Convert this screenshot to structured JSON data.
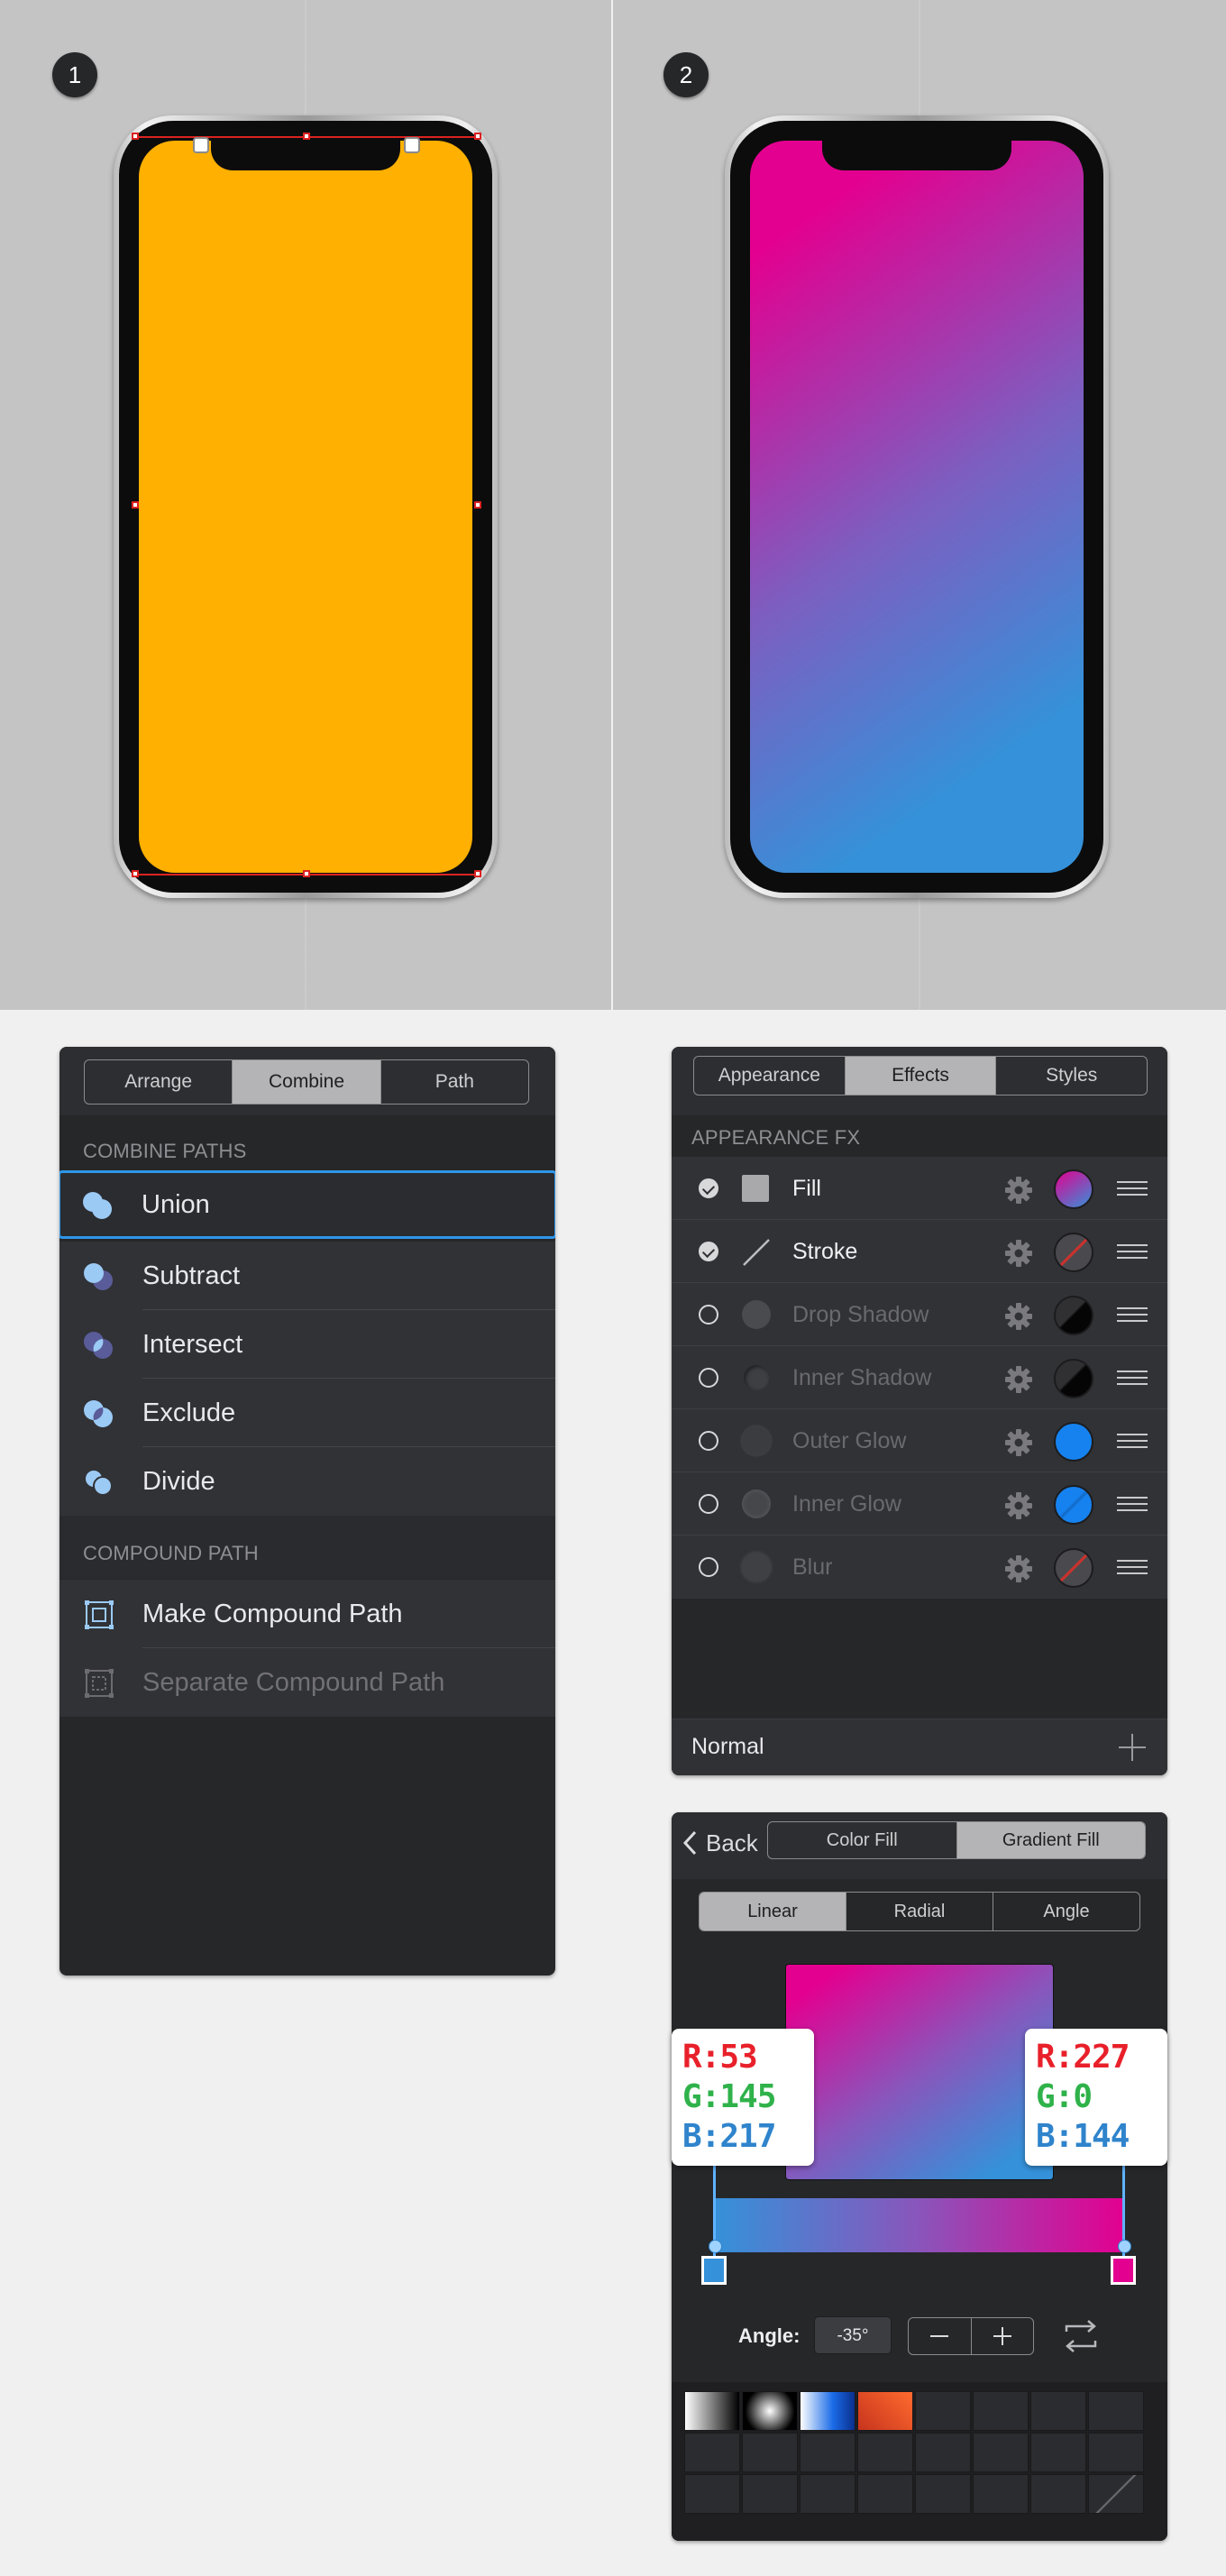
{
  "steps": [
    {
      "number": "1"
    },
    {
      "number": "2"
    }
  ],
  "arrange_panel": {
    "tabs": [
      "Arrange",
      "Combine",
      "Path"
    ],
    "active_tab": "Combine",
    "combine_paths": {
      "header": "COMBINE PATHS",
      "items": [
        {
          "label": "Union",
          "icon": "union-icon",
          "highlighted": true
        },
        {
          "label": "Subtract",
          "icon": "subtract-icon"
        },
        {
          "label": "Intersect",
          "icon": "intersect-icon"
        },
        {
          "label": "Exclude",
          "icon": "exclude-icon"
        },
        {
          "label": "Divide",
          "icon": "divide-icon"
        }
      ]
    },
    "compound_path": {
      "header": "COMPOUND PATH",
      "items": [
        {
          "label": "Make Compound Path",
          "icon": "make-compound-path-icon",
          "enabled": true
        },
        {
          "label": "Separate Compound Path",
          "icon": "separate-compound-path-icon",
          "enabled": false
        }
      ]
    }
  },
  "appearance_panel": {
    "tabs": [
      "Appearance",
      "Effects",
      "Styles"
    ],
    "active_tab": "Effects",
    "header": "APPEARANCE FX",
    "effects": [
      {
        "label": "Fill",
        "enabled": true
      },
      {
        "label": "Stroke",
        "enabled": true
      },
      {
        "label": "Drop Shadow",
        "enabled": false
      },
      {
        "label": "Inner Shadow",
        "enabled": false
      },
      {
        "label": "Outer Glow",
        "enabled": false
      },
      {
        "label": "Inner Glow",
        "enabled": false
      },
      {
        "label": "Blur",
        "enabled": false
      }
    ],
    "blend_mode": "Normal"
  },
  "gradient_panel": {
    "back_label": "Back",
    "fill_tabs": [
      "Color Fill",
      "Gradient Fill"
    ],
    "active_fill_tab": "Gradient Fill",
    "type_tabs": [
      "Linear",
      "Radial",
      "Angle"
    ],
    "active_type_tab": "Linear",
    "stops": [
      {
        "r_label": "R:53",
        "g_label": "G:145",
        "b_label": "B:217",
        "color": "#3591d9"
      },
      {
        "r_label": "R:227",
        "g_label": "G:0",
        "b_label": "B:144",
        "color": "#e30090"
      }
    ],
    "angle_label": "Angle:",
    "angle_value": "-35°"
  },
  "colors": {
    "fill_orange": "#ffb000",
    "gradient_start": "#3591d9",
    "gradient_end": "#e30090",
    "highlight_blue": "#2f96e8"
  }
}
